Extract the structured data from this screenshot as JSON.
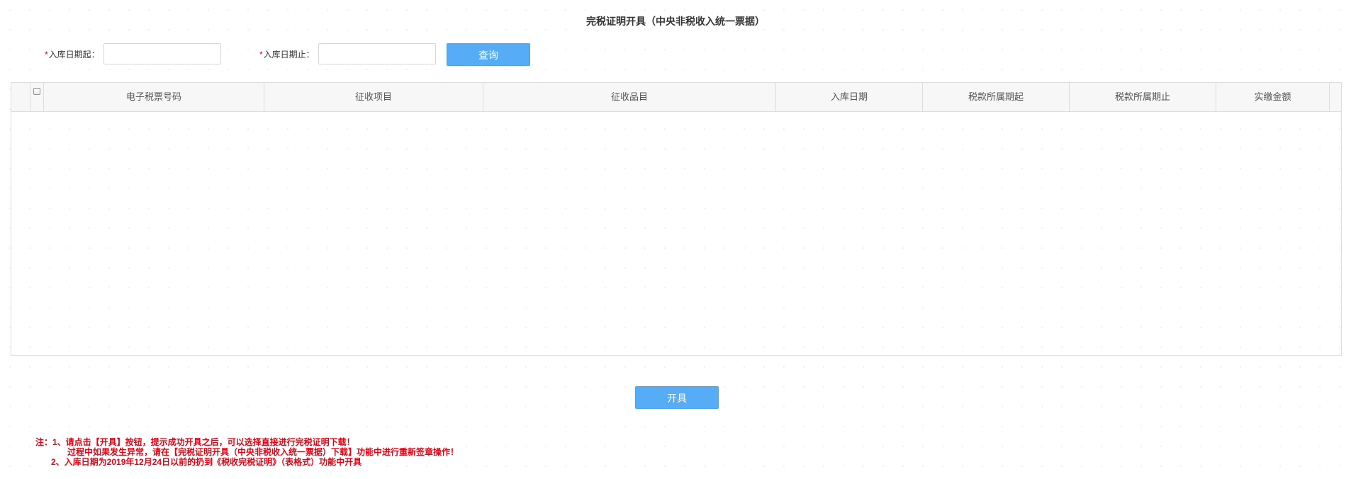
{
  "page": {
    "title": "完税证明开具（中央非税收入统一票据）"
  },
  "filters": {
    "required_mark": "*",
    "start_date_label": "入库日期起：",
    "start_date_value": "",
    "end_date_label": "入库日期止：",
    "end_date_value": "",
    "query_button": "查询"
  },
  "table": {
    "columns": [
      "电子税票号码",
      "征收项目",
      "征收品目",
      "入库日期",
      "税款所属期起",
      "税款所属期止",
      "实缴金额"
    ],
    "rows": []
  },
  "actions": {
    "issue_button": "开具"
  },
  "notes": {
    "line1": "注：1、请点击【开具】按钮，提示成功开具之后，可以选择直接进行完税证明下载！",
    "line2": "过程中如果发生异常，请在【完税证明开具（中央非税收入统一票据）下载】功能中进行重新签章操作！",
    "line3": "2、入库日期为2019年12月24日以前的扔到《税收完税证明》（表格式）功能中开具"
  },
  "colors": {
    "primary_button": "#56adf5",
    "note_text": "#e60012",
    "required_mark": "#e60012",
    "header_bg": "#f7f7f7",
    "border": "#dcdcdc"
  }
}
